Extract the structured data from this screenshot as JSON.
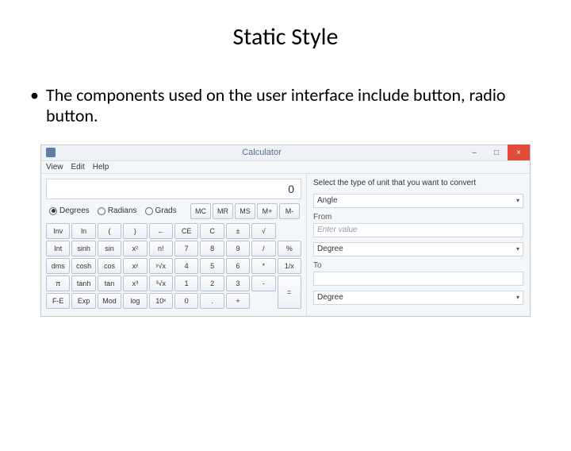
{
  "slide": {
    "title": "Static Style",
    "bullet": "The components used on the user interface include button, radio button."
  },
  "app": {
    "title": "Calculator",
    "window_buttons": {
      "min": "–",
      "max": "□",
      "close": "×"
    },
    "menu": [
      "View",
      "Edit",
      "Help"
    ],
    "display": "0",
    "angle_mode": {
      "options": [
        "Degrees",
        "Radians",
        "Grads"
      ],
      "selected": "Degrees"
    },
    "memory_buttons": [
      "MC",
      "MR",
      "MS",
      "M+",
      "M-"
    ],
    "button_rows": [
      [
        "Inv",
        "ln",
        "(",
        ")",
        "←",
        "CE",
        "C",
        "±",
        "√"
      ],
      [
        "Int",
        "sinh",
        "sin",
        "x²",
        "n!",
        "7",
        "8",
        "9",
        "/",
        "%"
      ],
      [
        "dms",
        "cosh",
        "cos",
        "xʸ",
        "ʸ√x",
        "4",
        "5",
        "6",
        "*",
        "1/x"
      ],
      [
        "π",
        "tanh",
        "tan",
        "x³",
        "³√x",
        "1",
        "2",
        "3",
        "-",
        "="
      ],
      [
        "F-E",
        "Exp",
        "Mod",
        "log",
        "10ˣ",
        "0",
        ".",
        "+"
      ]
    ],
    "converter": {
      "heading": "Select the type of unit that you want to convert",
      "category": {
        "value": "Angle"
      },
      "from": {
        "label": "From",
        "placeholder": "Enter value",
        "unit": "Degree"
      },
      "to": {
        "label": "To",
        "unit": "Degree"
      }
    }
  }
}
